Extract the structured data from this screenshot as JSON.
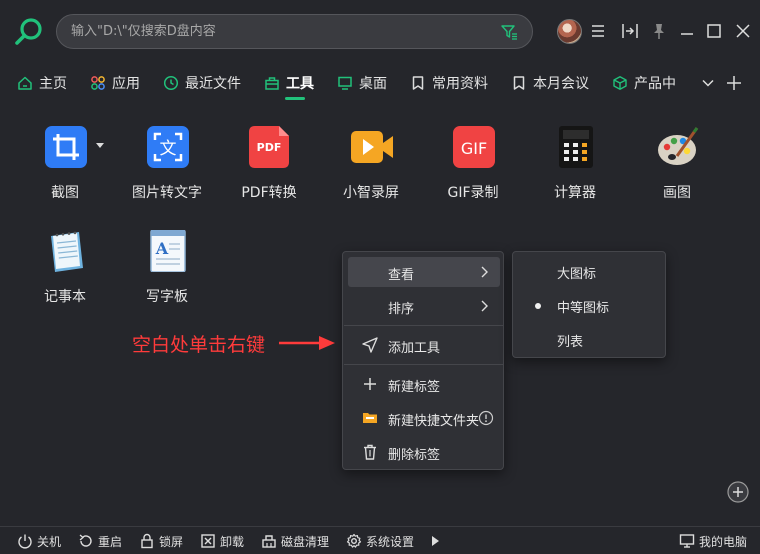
{
  "search": {
    "placeholder": "输入\"D:\\\"仅搜索D盘内容"
  },
  "nav": {
    "tabs": [
      {
        "label": "主页",
        "icon": "home-icon"
      },
      {
        "label": "应用",
        "icon": "apps-icon"
      },
      {
        "label": "最近文件",
        "icon": "clock-icon"
      },
      {
        "label": "工具",
        "icon": "toolbox-icon",
        "active": true
      },
      {
        "label": "桌面",
        "icon": "monitor-icon"
      },
      {
        "label": "常用资料",
        "icon": "bookmark-icon"
      },
      {
        "label": "本月会议",
        "icon": "bookmark-icon"
      },
      {
        "label": "产品中",
        "icon": "cube-icon"
      }
    ]
  },
  "tools": [
    {
      "label": "截图",
      "icon": "crop-icon"
    },
    {
      "label": "图片转文字",
      "icon": "image-to-text-icon"
    },
    {
      "label": "PDF转换",
      "icon": "pdf-icon"
    },
    {
      "label": "小智录屏",
      "icon": "video-camera-icon"
    },
    {
      "label": "GIF录制",
      "icon": "gif-icon"
    },
    {
      "label": "计算器",
      "icon": "calculator-icon"
    },
    {
      "label": "画图",
      "icon": "paint-palette-icon"
    },
    {
      "label": "记事本",
      "icon": "notepad-icon"
    },
    {
      "label": "写字板",
      "icon": "wordpad-icon"
    }
  ],
  "pdf_icon_text": "PDF",
  "gif_icon_text": "GIF",
  "context_menu": {
    "items": [
      {
        "label": "查看",
        "has_submenu": true
      },
      {
        "label": "排序",
        "has_submenu": true
      },
      {
        "label": "添加工具",
        "icon": "send-icon"
      },
      {
        "label": "新建标签",
        "icon": "plus-icon"
      },
      {
        "label": "新建快捷文件夹",
        "icon": "folder-icon",
        "info": true
      },
      {
        "label": "删除标签",
        "icon": "trash-icon"
      }
    ]
  },
  "submenu": {
    "items": [
      {
        "label": "大图标",
        "selected": false
      },
      {
        "label": "中等图标",
        "selected": true
      },
      {
        "label": "列表",
        "selected": false
      }
    ]
  },
  "annotation": "空白处单击右键",
  "bottom_bar": {
    "shutdown": "关机",
    "restart": "重启",
    "lock": "锁屏",
    "uninstall": "卸载",
    "disk_clean": "磁盘清理",
    "settings": "系统设置",
    "my_computer": "我的电脑"
  },
  "colors": {
    "accent": "#21c17b",
    "annotation": "#ff3b3b",
    "background": "#25262b"
  }
}
